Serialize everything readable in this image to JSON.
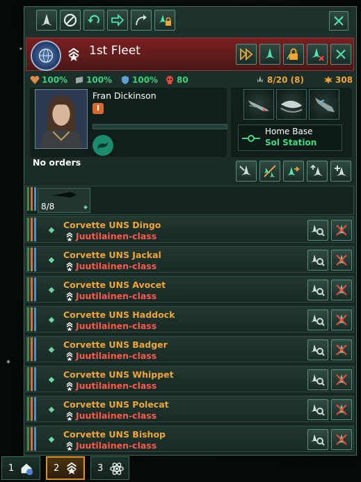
{
  "fleet": {
    "name": "1st Fleet",
    "stats": {
      "health": "100%",
      "armor": "100%",
      "shield": "100%",
      "danger": "80",
      "command_limit": "8/20 (8)",
      "power": "308"
    },
    "leader": {
      "name": "Fran Dickinson",
      "level": "I"
    },
    "orders": "No orders",
    "home_base": {
      "label": "Home Base",
      "value": "Sol Station"
    },
    "group": {
      "count": "8/8"
    }
  },
  "ships": [
    {
      "name": "Corvette UNS Dingo",
      "class": "Juutilainen-class"
    },
    {
      "name": "Corvette UNS Jackal",
      "class": "Juutilainen-class"
    },
    {
      "name": "Corvette UNS Avocet",
      "class": "Juutilainen-class"
    },
    {
      "name": "Corvette UNS Haddock",
      "class": "Juutilainen-class"
    },
    {
      "name": "Corvette UNS Badger",
      "class": "Juutilainen-class"
    },
    {
      "name": "Corvette UNS Whippet",
      "class": "Juutilainen-class"
    },
    {
      "name": "Corvette UNS Polecat",
      "class": "Juutilainen-class"
    },
    {
      "name": "Corvette UNS Bishop",
      "class": "Juutilainen-class"
    }
  ],
  "tabs": [
    {
      "number": "1"
    },
    {
      "number": "2"
    },
    {
      "number": "3"
    }
  ],
  "colors": {
    "ship_name": "#f0a535",
    "ship_class": "#ff5a4a",
    "stat_green": "#38d27a",
    "header_red": "#7a2020",
    "selected_tab": "#e0941f"
  }
}
